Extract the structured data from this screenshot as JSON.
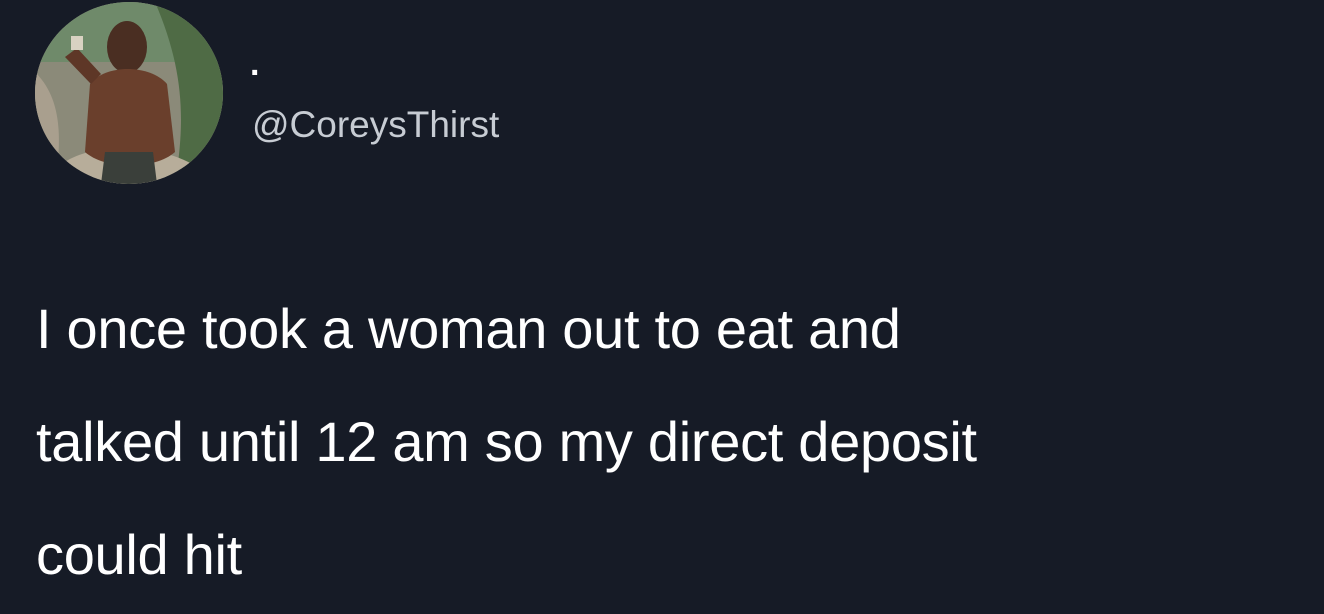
{
  "tweet": {
    "author": {
      "display_name": ".",
      "handle": "@CoreysThirst",
      "avatar": "profile-photo"
    },
    "text_lines": [
      "I once took a woman out to eat and",
      "talked until 12 am so my direct deposit",
      "could hit"
    ]
  },
  "colors": {
    "background": "#161b26",
    "text": "#ffffff",
    "handle": "#c7ccd3"
  }
}
